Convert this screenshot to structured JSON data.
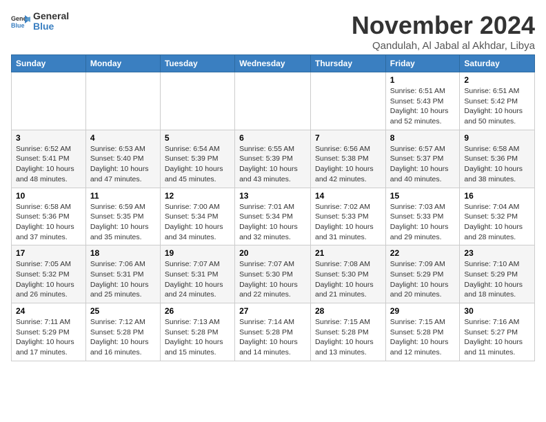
{
  "header": {
    "logo_general": "General",
    "logo_blue": "Blue",
    "month_year": "November 2024",
    "location": "Qandulah, Al Jabal al Akhdar, Libya"
  },
  "columns": [
    "Sunday",
    "Monday",
    "Tuesday",
    "Wednesday",
    "Thursday",
    "Friday",
    "Saturday"
  ],
  "weeks": [
    {
      "cells": [
        {
          "day": "",
          "sunrise": "",
          "sunset": "",
          "daylight": ""
        },
        {
          "day": "",
          "sunrise": "",
          "sunset": "",
          "daylight": ""
        },
        {
          "day": "",
          "sunrise": "",
          "sunset": "",
          "daylight": ""
        },
        {
          "day": "",
          "sunrise": "",
          "sunset": "",
          "daylight": ""
        },
        {
          "day": "",
          "sunrise": "",
          "sunset": "",
          "daylight": ""
        },
        {
          "day": "1",
          "sunrise": "Sunrise: 6:51 AM",
          "sunset": "Sunset: 5:43 PM",
          "daylight": "Daylight: 10 hours and 52 minutes."
        },
        {
          "day": "2",
          "sunrise": "Sunrise: 6:51 AM",
          "sunset": "Sunset: 5:42 PM",
          "daylight": "Daylight: 10 hours and 50 minutes."
        }
      ]
    },
    {
      "cells": [
        {
          "day": "3",
          "sunrise": "Sunrise: 6:52 AM",
          "sunset": "Sunset: 5:41 PM",
          "daylight": "Daylight: 10 hours and 48 minutes."
        },
        {
          "day": "4",
          "sunrise": "Sunrise: 6:53 AM",
          "sunset": "Sunset: 5:40 PM",
          "daylight": "Daylight: 10 hours and 47 minutes."
        },
        {
          "day": "5",
          "sunrise": "Sunrise: 6:54 AM",
          "sunset": "Sunset: 5:39 PM",
          "daylight": "Daylight: 10 hours and 45 minutes."
        },
        {
          "day": "6",
          "sunrise": "Sunrise: 6:55 AM",
          "sunset": "Sunset: 5:39 PM",
          "daylight": "Daylight: 10 hours and 43 minutes."
        },
        {
          "day": "7",
          "sunrise": "Sunrise: 6:56 AM",
          "sunset": "Sunset: 5:38 PM",
          "daylight": "Daylight: 10 hours and 42 minutes."
        },
        {
          "day": "8",
          "sunrise": "Sunrise: 6:57 AM",
          "sunset": "Sunset: 5:37 PM",
          "daylight": "Daylight: 10 hours and 40 minutes."
        },
        {
          "day": "9",
          "sunrise": "Sunrise: 6:58 AM",
          "sunset": "Sunset: 5:36 PM",
          "daylight": "Daylight: 10 hours and 38 minutes."
        }
      ]
    },
    {
      "cells": [
        {
          "day": "10",
          "sunrise": "Sunrise: 6:58 AM",
          "sunset": "Sunset: 5:36 PM",
          "daylight": "Daylight: 10 hours and 37 minutes."
        },
        {
          "day": "11",
          "sunrise": "Sunrise: 6:59 AM",
          "sunset": "Sunset: 5:35 PM",
          "daylight": "Daylight: 10 hours and 35 minutes."
        },
        {
          "day": "12",
          "sunrise": "Sunrise: 7:00 AM",
          "sunset": "Sunset: 5:34 PM",
          "daylight": "Daylight: 10 hours and 34 minutes."
        },
        {
          "day": "13",
          "sunrise": "Sunrise: 7:01 AM",
          "sunset": "Sunset: 5:34 PM",
          "daylight": "Daylight: 10 hours and 32 minutes."
        },
        {
          "day": "14",
          "sunrise": "Sunrise: 7:02 AM",
          "sunset": "Sunset: 5:33 PM",
          "daylight": "Daylight: 10 hours and 31 minutes."
        },
        {
          "day": "15",
          "sunrise": "Sunrise: 7:03 AM",
          "sunset": "Sunset: 5:33 PM",
          "daylight": "Daylight: 10 hours and 29 minutes."
        },
        {
          "day": "16",
          "sunrise": "Sunrise: 7:04 AM",
          "sunset": "Sunset: 5:32 PM",
          "daylight": "Daylight: 10 hours and 28 minutes."
        }
      ]
    },
    {
      "cells": [
        {
          "day": "17",
          "sunrise": "Sunrise: 7:05 AM",
          "sunset": "Sunset: 5:32 PM",
          "daylight": "Daylight: 10 hours and 26 minutes."
        },
        {
          "day": "18",
          "sunrise": "Sunrise: 7:06 AM",
          "sunset": "Sunset: 5:31 PM",
          "daylight": "Daylight: 10 hours and 25 minutes."
        },
        {
          "day": "19",
          "sunrise": "Sunrise: 7:07 AM",
          "sunset": "Sunset: 5:31 PM",
          "daylight": "Daylight: 10 hours and 24 minutes."
        },
        {
          "day": "20",
          "sunrise": "Sunrise: 7:07 AM",
          "sunset": "Sunset: 5:30 PM",
          "daylight": "Daylight: 10 hours and 22 minutes."
        },
        {
          "day": "21",
          "sunrise": "Sunrise: 7:08 AM",
          "sunset": "Sunset: 5:30 PM",
          "daylight": "Daylight: 10 hours and 21 minutes."
        },
        {
          "day": "22",
          "sunrise": "Sunrise: 7:09 AM",
          "sunset": "Sunset: 5:29 PM",
          "daylight": "Daylight: 10 hours and 20 minutes."
        },
        {
          "day": "23",
          "sunrise": "Sunrise: 7:10 AM",
          "sunset": "Sunset: 5:29 PM",
          "daylight": "Daylight: 10 hours and 18 minutes."
        }
      ]
    },
    {
      "cells": [
        {
          "day": "24",
          "sunrise": "Sunrise: 7:11 AM",
          "sunset": "Sunset: 5:29 PM",
          "daylight": "Daylight: 10 hours and 17 minutes."
        },
        {
          "day": "25",
          "sunrise": "Sunrise: 7:12 AM",
          "sunset": "Sunset: 5:28 PM",
          "daylight": "Daylight: 10 hours and 16 minutes."
        },
        {
          "day": "26",
          "sunrise": "Sunrise: 7:13 AM",
          "sunset": "Sunset: 5:28 PM",
          "daylight": "Daylight: 10 hours and 15 minutes."
        },
        {
          "day": "27",
          "sunrise": "Sunrise: 7:14 AM",
          "sunset": "Sunset: 5:28 PM",
          "daylight": "Daylight: 10 hours and 14 minutes."
        },
        {
          "day": "28",
          "sunrise": "Sunrise: 7:15 AM",
          "sunset": "Sunset: 5:28 PM",
          "daylight": "Daylight: 10 hours and 13 minutes."
        },
        {
          "day": "29",
          "sunrise": "Sunrise: 7:15 AM",
          "sunset": "Sunset: 5:28 PM",
          "daylight": "Daylight: 10 hours and 12 minutes."
        },
        {
          "day": "30",
          "sunrise": "Sunrise: 7:16 AM",
          "sunset": "Sunset: 5:27 PM",
          "daylight": "Daylight: 10 hours and 11 minutes."
        }
      ]
    }
  ]
}
